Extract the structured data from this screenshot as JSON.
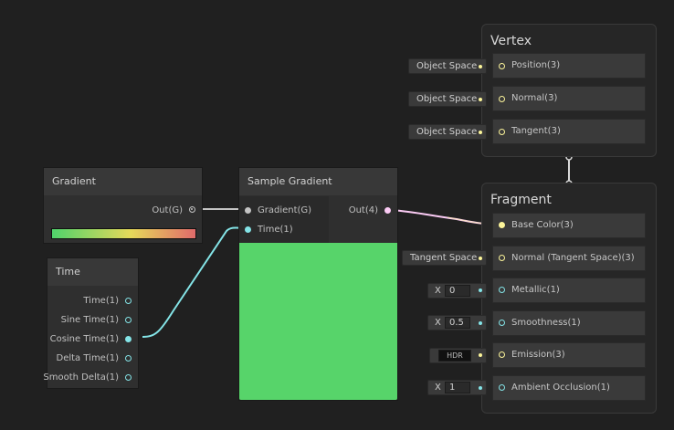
{
  "colors": {
    "background": "#202020",
    "vector3": "#fcf59a",
    "vector1": "#84e4e7",
    "vector4": "#fbcbf4",
    "gradient_port": "#c4c4c4",
    "preview_green": "#57d46a"
  },
  "vertex": {
    "title": "Vertex",
    "slots": [
      {
        "label": "Position(3)",
        "input": "Object Space"
      },
      {
        "label": "Normal(3)",
        "input": "Object Space"
      },
      {
        "label": "Tangent(3)",
        "input": "Object Space"
      }
    ]
  },
  "fragment": {
    "title": "Fragment",
    "slots": [
      {
        "label": "Base Color(3)"
      },
      {
        "label": "Normal (Tangent Space)(3)",
        "input": "Tangent Space"
      },
      {
        "label": "Metallic(1)",
        "axis": "X",
        "value": "0"
      },
      {
        "label": "Smoothness(1)",
        "axis": "X",
        "value": "0.5"
      },
      {
        "label": "Emission(3)",
        "input": "HDR"
      },
      {
        "label": "Ambient Occlusion(1)",
        "axis": "X",
        "value": "1"
      }
    ]
  },
  "gradient_node": {
    "title": "Gradient",
    "output": "Out(G)",
    "gradient_stops": [
      "#4fd36b",
      "#e6d95a",
      "#e06a6a"
    ]
  },
  "time_node": {
    "title": "Time",
    "outputs": [
      "Time(1)",
      "Sine Time(1)",
      "Cosine Time(1)",
      "Delta Time(1)",
      "Smooth Delta(1)"
    ]
  },
  "sample_gradient_node": {
    "title": "Sample Gradient",
    "inputs": [
      "Gradient(G)",
      "Time(1)"
    ],
    "output": "Out(4)"
  }
}
